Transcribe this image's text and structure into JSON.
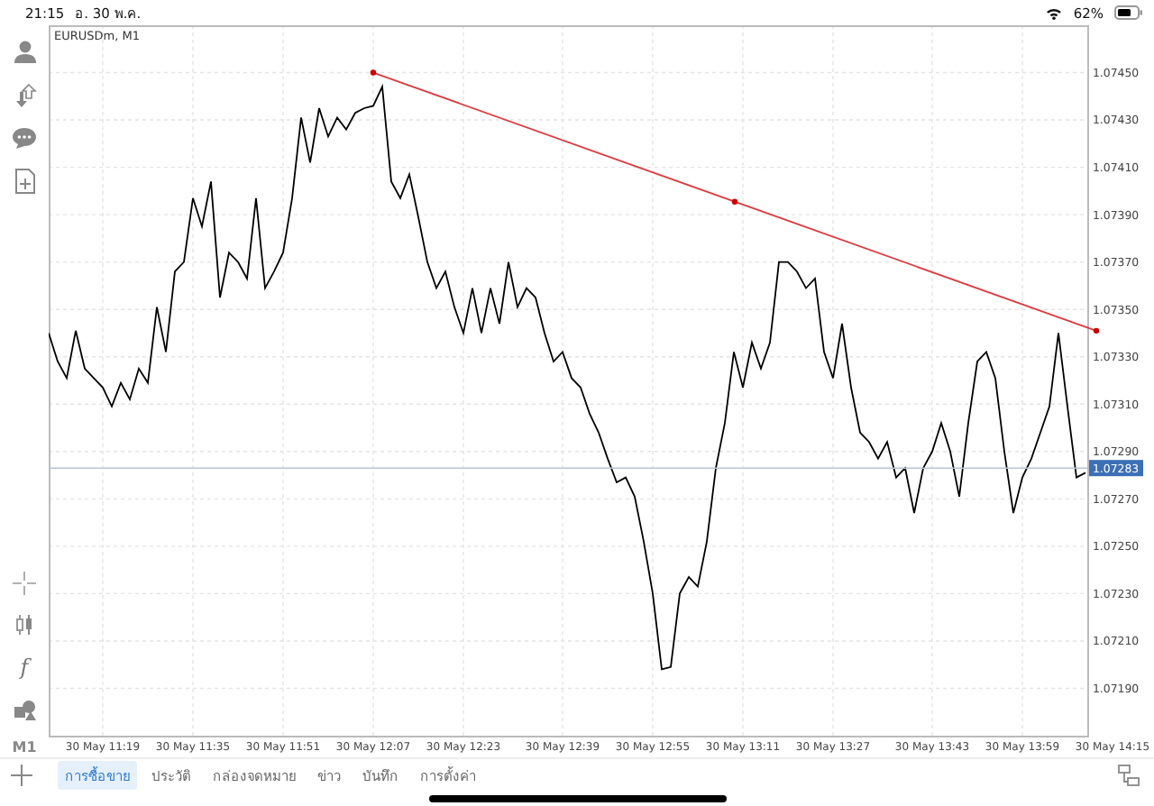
{
  "status_bar": {
    "time": "21:15",
    "date": "อ. 30 พ.ค.",
    "battery": "62%"
  },
  "left_toolbar": {
    "indicator_glyph": "f",
    "timeframe": "M1"
  },
  "chart": {
    "title": "EURUSDm, M1",
    "chart_data": {
      "type": "line",
      "categories": [
        null,
        null,
        null,
        null,
        null,
        null,
        "30 May 11:19",
        null,
        null,
        null,
        null,
        null,
        null,
        null,
        null,
        null,
        "30 May 11:35",
        null,
        null,
        null,
        null,
        null,
        null,
        null,
        null,
        null,
        "30 May 11:51",
        null,
        null,
        null,
        null,
        null,
        null,
        null,
        null,
        null,
        "30 May 12:07",
        null,
        null,
        null,
        null,
        null,
        null,
        null,
        null,
        null,
        "30 May 12:23",
        null,
        null,
        null,
        null,
        null,
        null,
        null,
        null,
        null,
        null,
        "30 May 12:39",
        null,
        null,
        null,
        null,
        null,
        null,
        null,
        null,
        null,
        "30 May 12:55",
        null,
        null,
        null,
        null,
        null,
        null,
        null,
        null,
        null,
        "30 May 13:11",
        null,
        null,
        null,
        null,
        null,
        null,
        null,
        null,
        null,
        "30 May 13:27",
        null,
        null,
        null,
        null,
        null,
        null,
        null,
        null,
        null,
        null,
        "30 May 13:43",
        null,
        null,
        null,
        null,
        null,
        null,
        null,
        null,
        null,
        "30 May 13:59",
        null,
        null,
        null,
        null,
        null,
        null,
        null,
        null,
        null,
        "30 May 14:15"
      ],
      "series": [
        {
          "color": "#000000",
          "values": [
            1.0734,
            1.07328,
            1.07321,
            1.07341,
            1.07325,
            1.07321,
            1.07317,
            1.07309,
            1.07319,
            1.07312,
            1.07325,
            1.07319,
            1.07351,
            1.07332,
            1.07366,
            1.0737,
            1.07397,
            1.07385,
            1.07404,
            1.07355,
            1.07374,
            1.0737,
            1.07363,
            1.07397,
            1.07359,
            1.07366,
            1.07374,
            1.07397,
            1.07431,
            1.07412,
            1.07435,
            1.07423,
            1.07431,
            1.07426,
            1.07433,
            1.07435,
            1.07436,
            1.07444,
            1.07404,
            1.07397,
            1.07407,
            1.07389,
            1.0737,
            1.07359,
            1.07366,
            1.07351,
            1.0734,
            1.07359,
            1.0734,
            1.07359,
            1.07344,
            1.0737,
            1.07351,
            1.07359,
            1.07355,
            1.0734,
            1.07328,
            1.07332,
            1.07321,
            1.07317,
            1.07306,
            1.07298,
            1.07287,
            1.07277,
            1.07279,
            1.07271,
            1.07252,
            1.0723,
            1.07198,
            1.07199,
            1.0723,
            1.07237,
            1.07233,
            1.07252,
            1.07283,
            1.07302,
            1.07332,
            1.07317,
            1.07336,
            1.07325,
            1.07336,
            1.0737,
            1.0737,
            1.07366,
            1.07359,
            1.07363,
            1.07332,
            1.07321,
            1.07344,
            1.07317,
            1.07298,
            1.07294,
            1.07287,
            1.07294,
            1.07279,
            1.07283,
            1.07264,
            1.07283,
            1.0729,
            1.07302,
            1.0729,
            1.07271,
            1.07302,
            1.07328,
            1.07332,
            1.07321,
            1.0729,
            1.07264,
            1.07279,
            1.07287,
            1.07298,
            1.07309,
            1.0734,
            1.07309,
            1.07279,
            1.07281,
            null,
            null,
            null
          ]
        }
      ],
      "ylim": [
        1.0717,
        1.0747
      ],
      "yticks": [
        {
          "value": 1.0745,
          "label": "1.07450"
        },
        {
          "value": 1.0743,
          "label": "1.07430"
        },
        {
          "value": 1.0741,
          "label": "1.07410"
        },
        {
          "value": 1.0739,
          "label": "1.07390"
        },
        {
          "value": 1.0737,
          "label": "1.07370"
        },
        {
          "value": 1.0735,
          "label": "1.07350"
        },
        {
          "value": 1.0733,
          "label": "1.07330"
        },
        {
          "value": 1.0731,
          "label": "1.07310"
        },
        {
          "value": 1.0729,
          "label": "1.07290"
        },
        {
          "value": 1.0727,
          "label": "1.07270"
        },
        {
          "value": 1.0725,
          "label": "1.07250"
        },
        {
          "value": 1.0723,
          "label": "1.07230"
        },
        {
          "value": 1.0721,
          "label": "1.07210"
        },
        {
          "value": 1.0719,
          "label": "1.07190"
        }
      ],
      "grid": true
    },
    "current_price": "1.07283"
  },
  "bottom_tabs": [
    {
      "label": "การซื้อขาย",
      "selected": true
    },
    {
      "label": "ประวัติ",
      "selected": false
    },
    {
      "label": "กล่องจดหมาย",
      "selected": false
    },
    {
      "label": "ข่าว",
      "selected": false
    },
    {
      "label": "บันทึก",
      "selected": false
    },
    {
      "label": "การตั้งค่า",
      "selected": false
    }
  ]
}
